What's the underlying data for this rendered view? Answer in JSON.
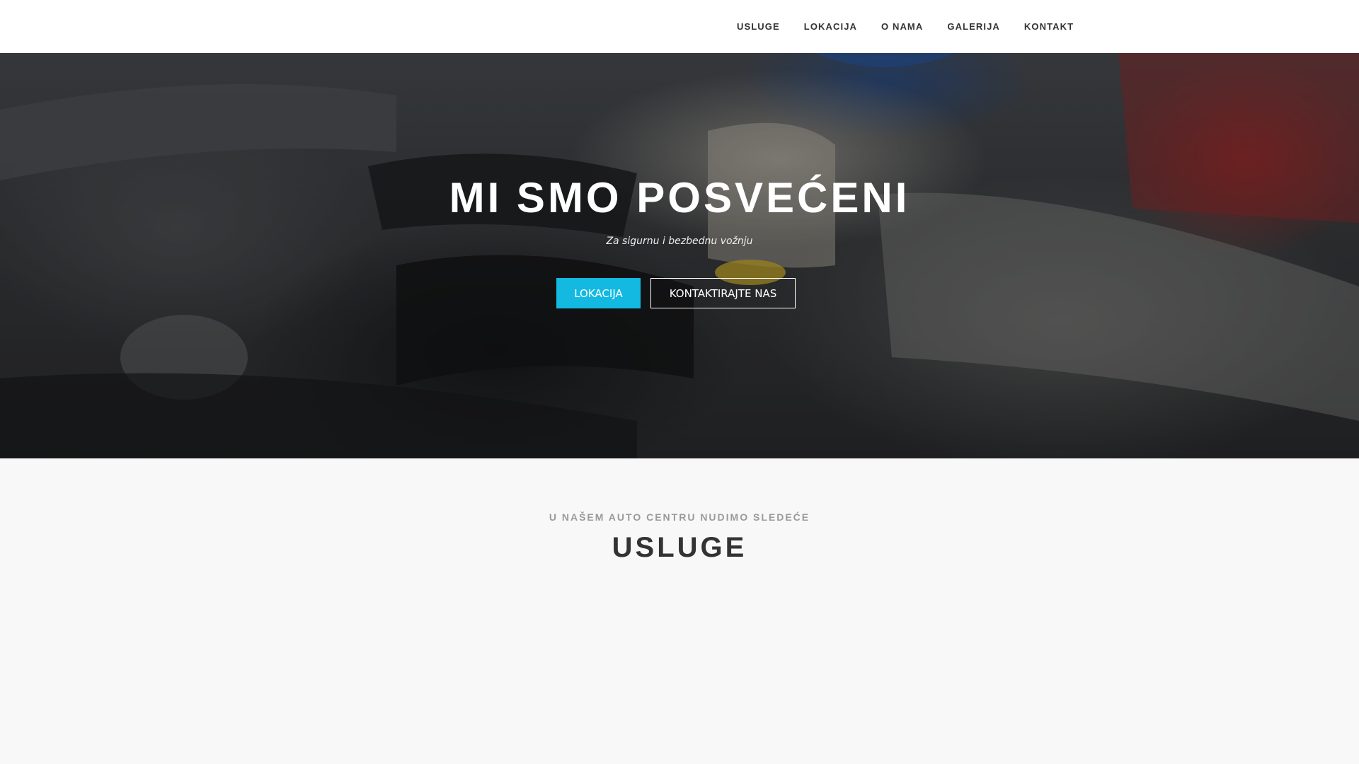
{
  "nav": {
    "items": [
      {
        "label": "USLUGE"
      },
      {
        "label": "LOKACIJA"
      },
      {
        "label": "O NAMA"
      },
      {
        "label": "GALERIJA"
      },
      {
        "label": "KONTAKT"
      }
    ]
  },
  "hero": {
    "title": "MI SMO POSVEĆENI",
    "subtitle": "Za sigurnu i bezbednu vožnju",
    "primary_button": "LOKACIJA",
    "secondary_button": "KONTAKTIRAJTE NAS",
    "accent_color": "#13b9e0"
  },
  "services": {
    "kicker": "U NAŠEM AUTO CENTRU NUDIMO SLEDEĆE",
    "title": "USLUGE"
  }
}
